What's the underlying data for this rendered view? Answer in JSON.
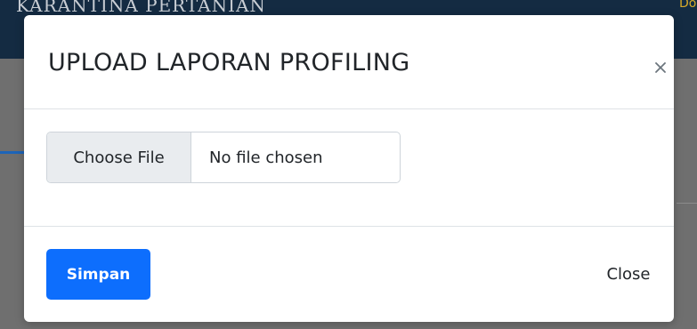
{
  "background": {
    "header_title": "KARANTINA PERTANIAN",
    "header_link": "Download"
  },
  "modal": {
    "title": "UPLOAD LAPORAN PROFILING",
    "close_icon": "close-x-icon",
    "file_input": {
      "button_label": "Choose File",
      "status": "No file chosen"
    },
    "footer": {
      "save_label": "Simpan",
      "close_label": "Close"
    }
  },
  "colors": {
    "primary": "#0d6efd",
    "header_bg": "#142b42",
    "overlay": "#6f6f6f",
    "link_accent": "#d6a92a"
  }
}
